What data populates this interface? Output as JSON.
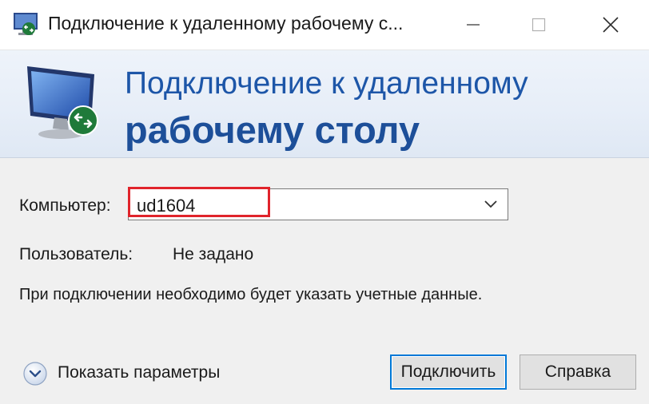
{
  "window": {
    "title": "Подключение к удаленному рабочему с...",
    "controls": [
      "minimize-icon",
      "maximize-icon",
      "close-icon"
    ]
  },
  "banner": {
    "line1": "Подключение к удаленному",
    "line2": "рабочему столу",
    "icon": "remote-desktop-icon"
  },
  "form": {
    "computer_label": "Компьютер:",
    "computer_value": "ud1604",
    "user_label": "Пользователь:",
    "user_value": "Не задано",
    "info": "При подключении необходимо будет указать учетные данные."
  },
  "footer": {
    "show_options": "Показать параметры",
    "connect": "Подключить",
    "help": "Справка"
  },
  "colors": {
    "banner_text": "#1d56a8",
    "highlight": "#e0242b",
    "default_button_border": "#0078d7"
  }
}
